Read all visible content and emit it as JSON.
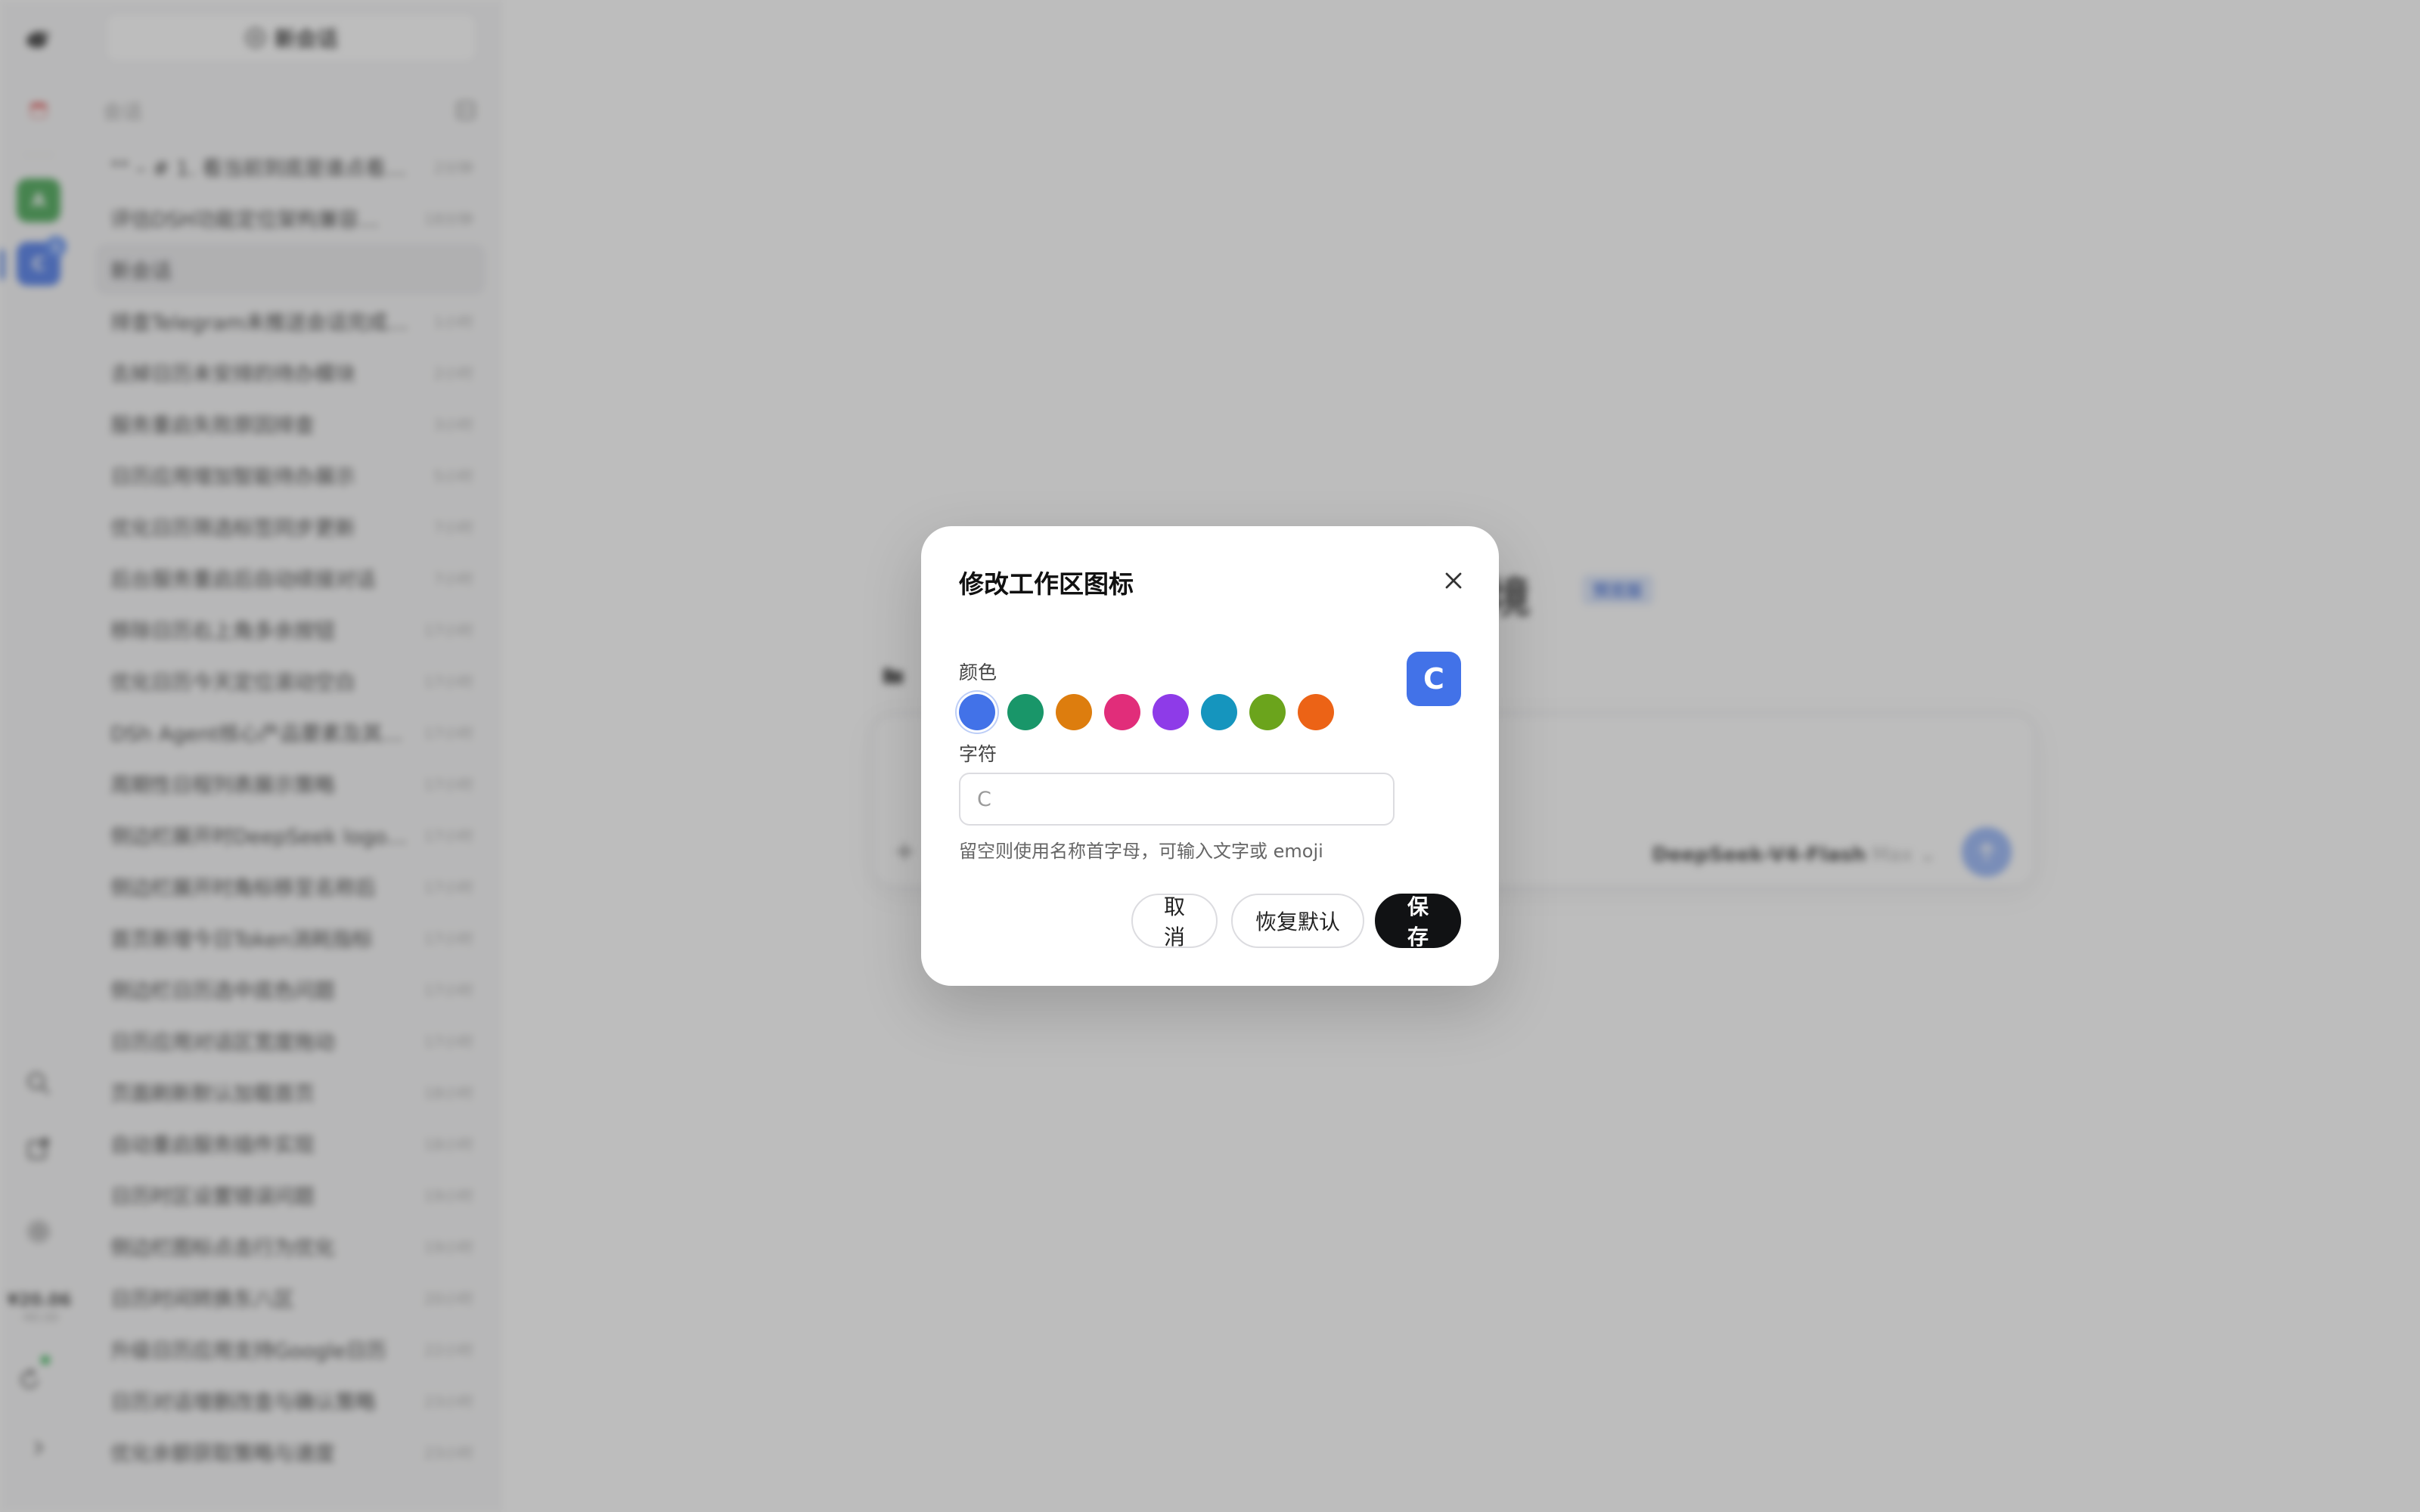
{
  "sidebar": {
    "new_chat_label": "新会话",
    "section_label": "会话",
    "conversations": [
      {
        "title": "\"\" – # 1. 看当前到底是谁点看…",
        "time": "2分钟"
      },
      {
        "title": "评估DSH功能定位架构兼容…",
        "time": "18分钟"
      },
      {
        "title": "新会话",
        "time": ""
      },
      {
        "title": "排查Telegram未推送会话完成…",
        "time": "1小时"
      },
      {
        "title": "去掉日历未安排的待办模块",
        "time": "2小时"
      },
      {
        "title": "服务重启失败原因排查",
        "time": "3小时"
      },
      {
        "title": "日历应用增加智能待办展示",
        "time": "5小时"
      },
      {
        "title": "优化日历筛选标签同步更新",
        "time": "7小时"
      },
      {
        "title": "后台服务重启后自动续接对话",
        "time": "7小时"
      },
      {
        "title": "移除日历右上角多余按钮",
        "time": "17小时"
      },
      {
        "title": "优化日历今天定位滚动空白",
        "time": "17小时"
      },
      {
        "title": "DSh Agent核心产品要素及其…",
        "time": "17小时"
      },
      {
        "title": "周期性日程列表展示策略",
        "time": "17小时"
      },
      {
        "title": "侧边栏展开时DeepSeek logo…",
        "time": "17小时"
      },
      {
        "title": "侧边栏展开时角标移至名称后",
        "time": "17小时"
      },
      {
        "title": "首页新增今日Token消耗指标",
        "time": "17小时"
      },
      {
        "title": "侧边栏日历选中底色问题",
        "time": "17小时"
      },
      {
        "title": "日历应用对话区宽度拖动",
        "time": "17小时"
      },
      {
        "title": "页面刷新默认加载首页",
        "time": "18小时"
      },
      {
        "title": "自动重启服务插件实现",
        "time": "18小时"
      },
      {
        "title": "日历时区设置错误问题",
        "time": "19小时"
      },
      {
        "title": "侧边栏图标点击行为优化",
        "time": "19小时"
      },
      {
        "title": "日历时间转换东八区",
        "time": "20小时"
      },
      {
        "title": "升级日历应用支持Google日历",
        "time": "22小时"
      },
      {
        "title": "日历对话增删改查与确认策略",
        "time": "23小时"
      },
      {
        "title": "优化余额获取策略与速度",
        "time": "23小时"
      }
    ]
  },
  "rail": {
    "workspace_a_letter": "A",
    "workspace_c_letter": "C",
    "workspace_c_badge": "1",
    "balance_amount": "¥20.06",
    "balance_sub": "-¥0.00",
    "color_workspace_a": "#3aa048",
    "color_workspace_c": "#4272e8"
  },
  "main": {
    "hero_title": "之境",
    "hero_badge": "预览版",
    "composer_model": "DeepSeek-V4-Flash",
    "composer_mode": "Max"
  },
  "modal": {
    "title": "修改工作区图标",
    "color_label": "颜色",
    "char_label": "字符",
    "char_placeholder": "C",
    "char_value": "",
    "hint": "留空则使用名称首字母，可输入文字或 emoji",
    "preview_char": "C",
    "selected_color": "#4272e8",
    "swatches": [
      "#4272e8",
      "#199669",
      "#dd7d0e",
      "#e12d7a",
      "#8e3be8",
      "#1595be",
      "#6ba41c",
      "#ec6316"
    ],
    "cancel_label": "取消",
    "reset_label": "恢复默认",
    "save_label": "保存"
  }
}
